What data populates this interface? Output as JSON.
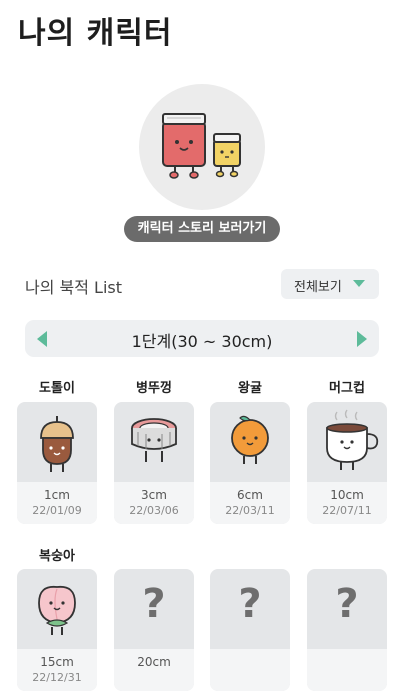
{
  "title": "나의 캐릭터",
  "story_button": "캐릭터 스토리 보러가기",
  "list_title": "나의 북적 List",
  "view_all": "전체보기",
  "stage_label": "1단계(30 ~ 30cm)",
  "accent_color": "#5dbb9a",
  "characters": [
    {
      "name": "도톨이",
      "length": "1cm",
      "date": "22/01/09",
      "icon": "acorn-icon"
    },
    {
      "name": "병뚜껑",
      "length": "3cm",
      "date": "22/03/06",
      "icon": "bottle-cap-icon"
    },
    {
      "name": "왕귤",
      "length": "6cm",
      "date": "22/03/11",
      "icon": "tangerine-icon"
    },
    {
      "name": "머그컵",
      "length": "10cm",
      "date": "22/07/11",
      "icon": "mug-icon"
    },
    {
      "name": "복숭아",
      "length": "15cm",
      "date": "22/12/31",
      "icon": "peach-icon"
    },
    {
      "name": "",
      "length": "20cm",
      "date": "",
      "icon": "question-icon",
      "mystery": "?"
    },
    {
      "name": "",
      "length": "",
      "date": "",
      "icon": "question-icon",
      "mystery": "?"
    },
    {
      "name": "",
      "length": "",
      "date": "",
      "icon": "question-icon",
      "mystery": "?"
    }
  ]
}
